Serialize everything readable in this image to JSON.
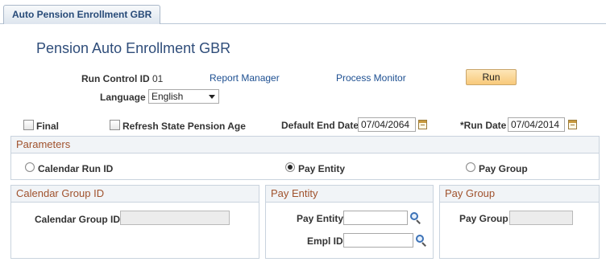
{
  "tab": {
    "label": "Auto Pension Enrollment GBR"
  },
  "page": {
    "title": "Pension Auto Enrollment GBR"
  },
  "run_control": {
    "label": "Run Control ID",
    "value": "01",
    "report_manager": "Report Manager",
    "process_monitor": "Process Monitor",
    "run_button": "Run"
  },
  "language": {
    "label": "Language",
    "selected": "English"
  },
  "options": {
    "final_label": "Final",
    "final_checked": false,
    "refresh_label": "Refresh State Pension Age",
    "refresh_checked": false,
    "default_end_date_label": "Default End Date",
    "default_end_date": "07/04/2064",
    "run_date_label": "*Run Date",
    "run_date": "07/04/2014"
  },
  "parameters": {
    "header": "Parameters",
    "radios": [
      {
        "label": "Calendar Run ID",
        "selected": false
      },
      {
        "label": "Pay Entity",
        "selected": true
      },
      {
        "label": "Pay Group",
        "selected": false
      }
    ]
  },
  "calendar_group": {
    "header": "Calendar Group ID",
    "field_label": "Calendar Group ID",
    "value": ""
  },
  "pay_entity": {
    "header": "Pay Entity",
    "pay_entity_label": "Pay Entity",
    "pay_entity_value": "",
    "empl_id_label": "Empl ID",
    "empl_id_value": ""
  },
  "pay_group": {
    "header": "Pay Group",
    "field_label": "Pay Group",
    "value": ""
  },
  "colors": {
    "title": "#2f4d7a",
    "link": "#1d4f91",
    "section_header": "#a0522d",
    "button": "#f8c97a"
  }
}
